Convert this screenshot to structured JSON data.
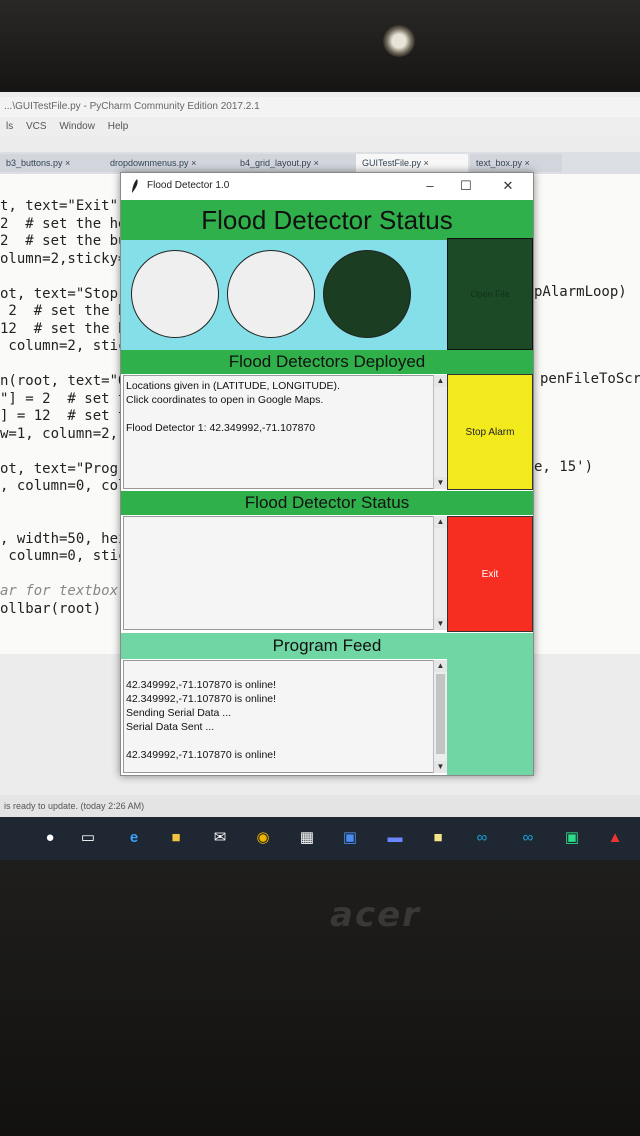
{
  "ide": {
    "title": "...\\GUITestFile.py - PyCharm Community Edition 2017.2.1",
    "menu": [
      "ls",
      "VCS",
      "Window",
      "Help"
    ],
    "tabs": [
      {
        "label": "b3_buttons.py",
        "active": false
      },
      {
        "label": "dropdownmenus.py",
        "active": false
      },
      {
        "label": "b4_grid_layout.py",
        "active": false
      },
      {
        "label": "GUITestFile.py",
        "active": true
      },
      {
        "label": "text_box.py",
        "active": false
      }
    ],
    "code_left": [
      "t, text=\"Exit\",",
      "2  # set the he",
      "2  # set the bu",
      "olumn=2,sticky=",
      "",
      "ot, text=\"Stop",
      " 2  # set the h",
      "12  # set the b",
      " column=2, stic",
      "",
      "n(root, text=\"O",
      "\"] = 2  # set t",
      "] = 12  # set t",
      "w=1, column=2,",
      "",
      "ot, text=\"Progr",
      ", column=0, col",
      "",
      "",
      ", width=50, hei",
      " column=0, stic",
      "",
      "ar for textbox",
      "ollbar(root)"
    ],
    "code_right": [
      "pAlarmLoop)",
      "penFileToScr",
      "e, 15')"
    ],
    "status": "is ready to update. (today 2:26 AM)",
    "brand": "acer"
  },
  "window": {
    "title": "Flood Detector 1.0",
    "minimize": "–",
    "maximize": "☐",
    "close": "✕"
  },
  "header": "Flood Detector Status",
  "circles": [
    {
      "color": "#efefef"
    },
    {
      "color": "#efefef"
    },
    {
      "color": "#1b3d22"
    }
  ],
  "buttons": {
    "open_file": "Open File",
    "stop_alarm": "Stop Alarm",
    "exit": "Exit"
  },
  "sections": {
    "deployed": "Flood Detectors Deployed",
    "status": "Flood Detector Status",
    "feed": "Program Feed"
  },
  "deployed_lines": [
    "Locations given in (LATITUDE, LONGITUDE).",
    "Click coordinates to open in Google Maps.",
    "",
    "Flood Detector 1: 42.349992,-71.107870"
  ],
  "status_lines": [],
  "feed_lines": [
    "",
    "42.349992,-71.107870 is online!",
    "42.349992,-71.107870 is online!",
    "Sending Serial Data ...",
    "Serial Data Sent ...",
    "",
    "42.349992,-71.107870 is online!"
  ],
  "colors": {
    "header_green": "#2fb04a",
    "cyan_panel": "#85dfe9",
    "stop_yellow": "#f2ea1d",
    "exit_red": "#f62e22",
    "feed_mint": "#6fd6a4"
  }
}
